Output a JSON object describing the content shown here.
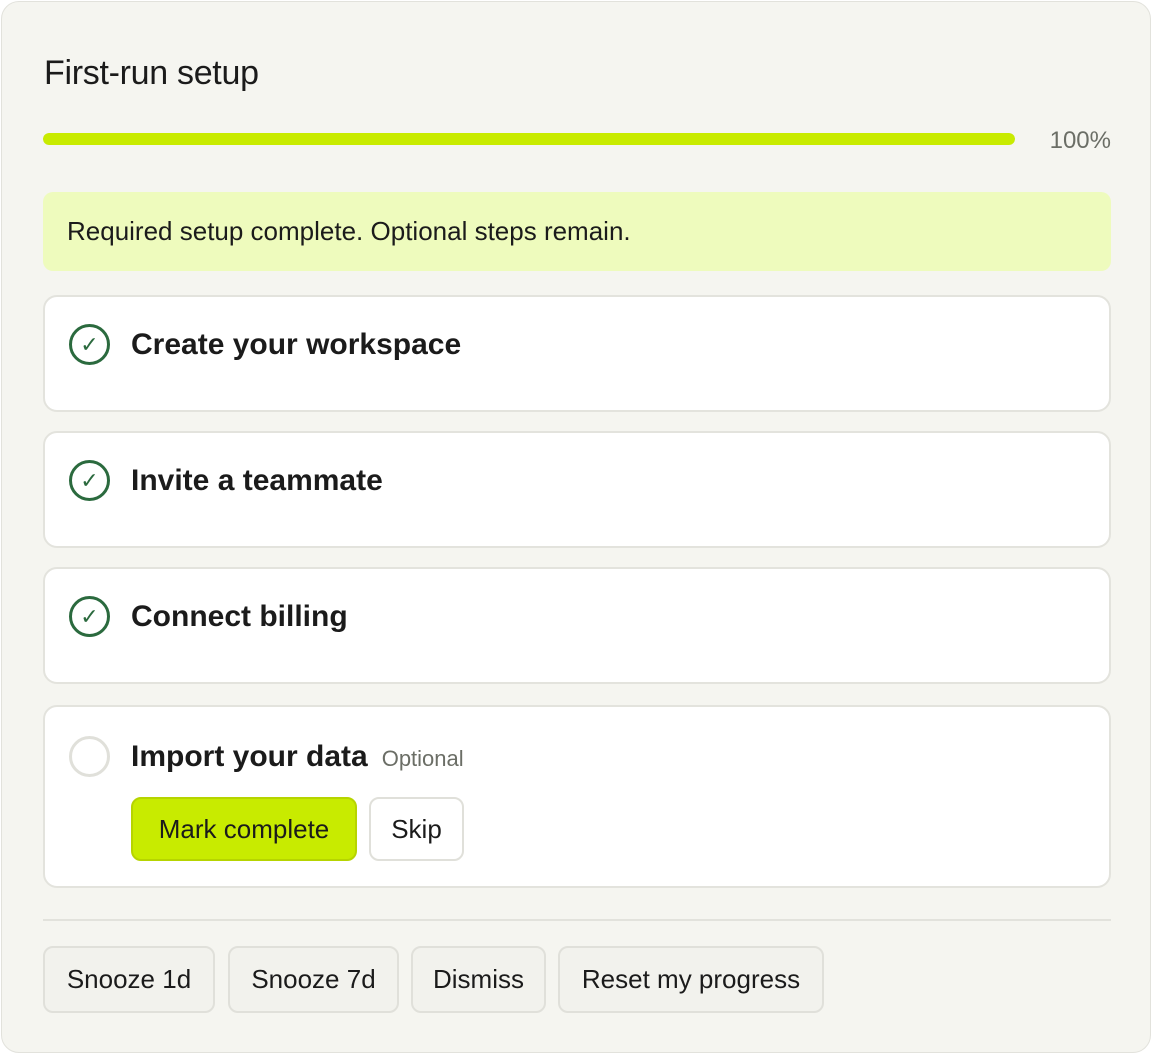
{
  "header": {
    "title": "First-run setup"
  },
  "progress": {
    "percent_label": "100%",
    "fraction": 1.0,
    "fill_color": "#c8eb00"
  },
  "banner": {
    "text": "Required setup complete. Optional steps remain.",
    "bg_color": "#eefbbd"
  },
  "steps": [
    {
      "label": "Create your workspace",
      "done": true,
      "icon": "check-circle-icon"
    },
    {
      "label": "Invite a teammate",
      "done": true,
      "icon": "check-circle-icon"
    },
    {
      "label": "Connect billing",
      "done": true,
      "icon": "check-circle-icon"
    },
    {
      "label": "Import your data",
      "done": false,
      "icon": "empty-circle-icon",
      "tag": "Optional",
      "actions": {
        "mark_complete": "Mark complete",
        "skip": "Skip"
      }
    }
  ],
  "check_glyph": "✓",
  "footer": {
    "snooze_1d": "Snooze 1d",
    "snooze_7d": "Snooze 7d",
    "dismiss": "Dismiss",
    "reset": "Reset my progress"
  },
  "colors": {
    "accent": "#c8eb00",
    "check": "#2b6a3e"
  }
}
